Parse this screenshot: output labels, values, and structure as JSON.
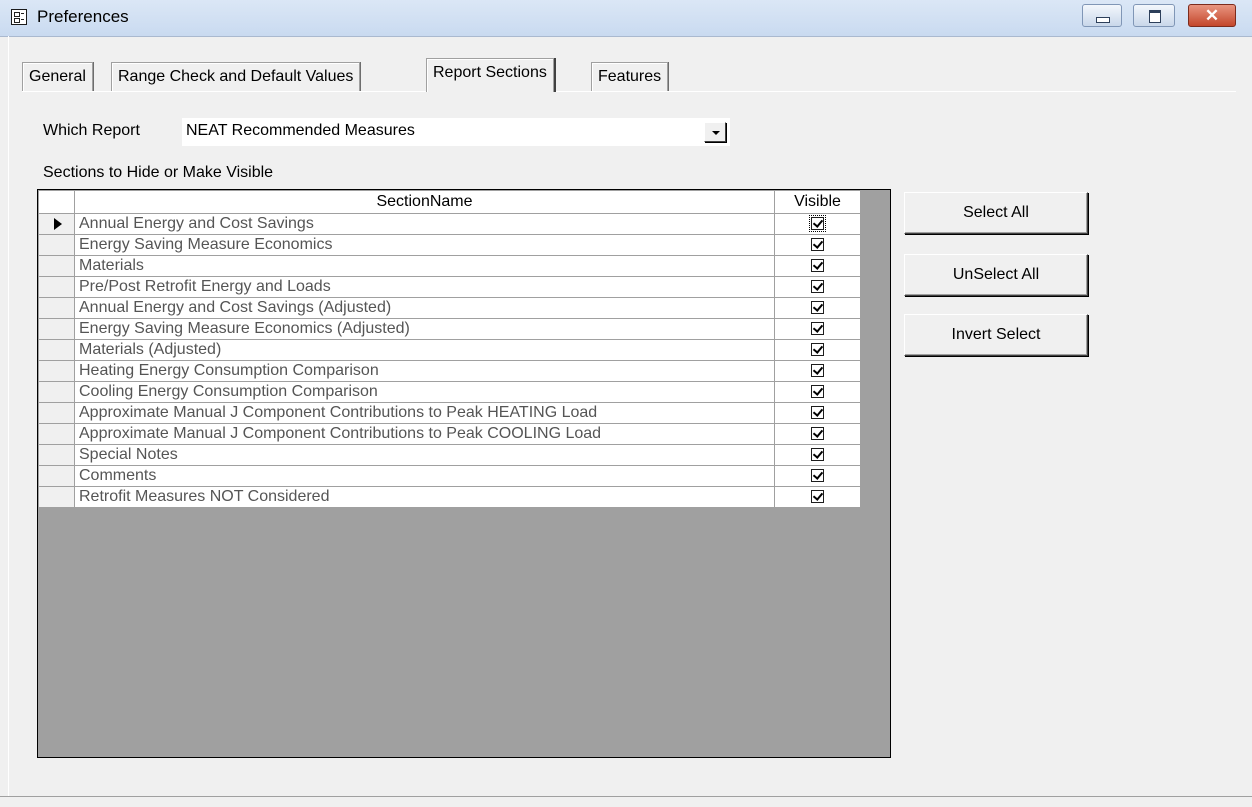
{
  "window": {
    "title": "Preferences",
    "icon": "form-icon",
    "controls": {
      "minimize": "minimize-icon",
      "maximize": "maximize-icon",
      "close": "✕"
    }
  },
  "tabs": [
    {
      "label": "General",
      "active": false
    },
    {
      "label": "Range Check and Default Values",
      "active": false
    },
    {
      "label": "Report Sections",
      "active": true
    },
    {
      "label": "Features",
      "active": false
    }
  ],
  "report": {
    "label": "Which Report",
    "selected": "NEAT Recommended Measures"
  },
  "sections": {
    "caption": "Sections to Hide or Make Visible",
    "columns": {
      "name": "SectionName",
      "visible": "Visible"
    },
    "rows": [
      {
        "name": "Annual Energy and Cost Savings",
        "visible": true,
        "current": true
      },
      {
        "name": "Energy Saving Measure Economics",
        "visible": true
      },
      {
        "name": "Materials",
        "visible": true
      },
      {
        "name": "Pre/Post Retrofit Energy and Loads",
        "visible": true
      },
      {
        "name": "Annual Energy and Cost Savings (Adjusted)",
        "visible": true
      },
      {
        "name": "Energy Saving Measure Economics (Adjusted)",
        "visible": true
      },
      {
        "name": "Materials (Adjusted)",
        "visible": true
      },
      {
        "name": "Heating Energy Consumption Comparison",
        "visible": true
      },
      {
        "name": "Cooling Energy Consumption Comparison",
        "visible": true
      },
      {
        "name": "Approximate Manual J Component Contributions to Peak HEATING Load",
        "visible": true
      },
      {
        "name": "Approximate Manual J Component Contributions to Peak COOLING Load",
        "visible": true
      },
      {
        "name": "Special Notes",
        "visible": true
      },
      {
        "name": "Comments",
        "visible": true
      },
      {
        "name": "Retrofit Measures NOT Considered",
        "visible": true
      }
    ]
  },
  "buttons": {
    "select_all": "Select All",
    "unselect_all": "UnSelect All",
    "invert_select": "Invert Select"
  }
}
